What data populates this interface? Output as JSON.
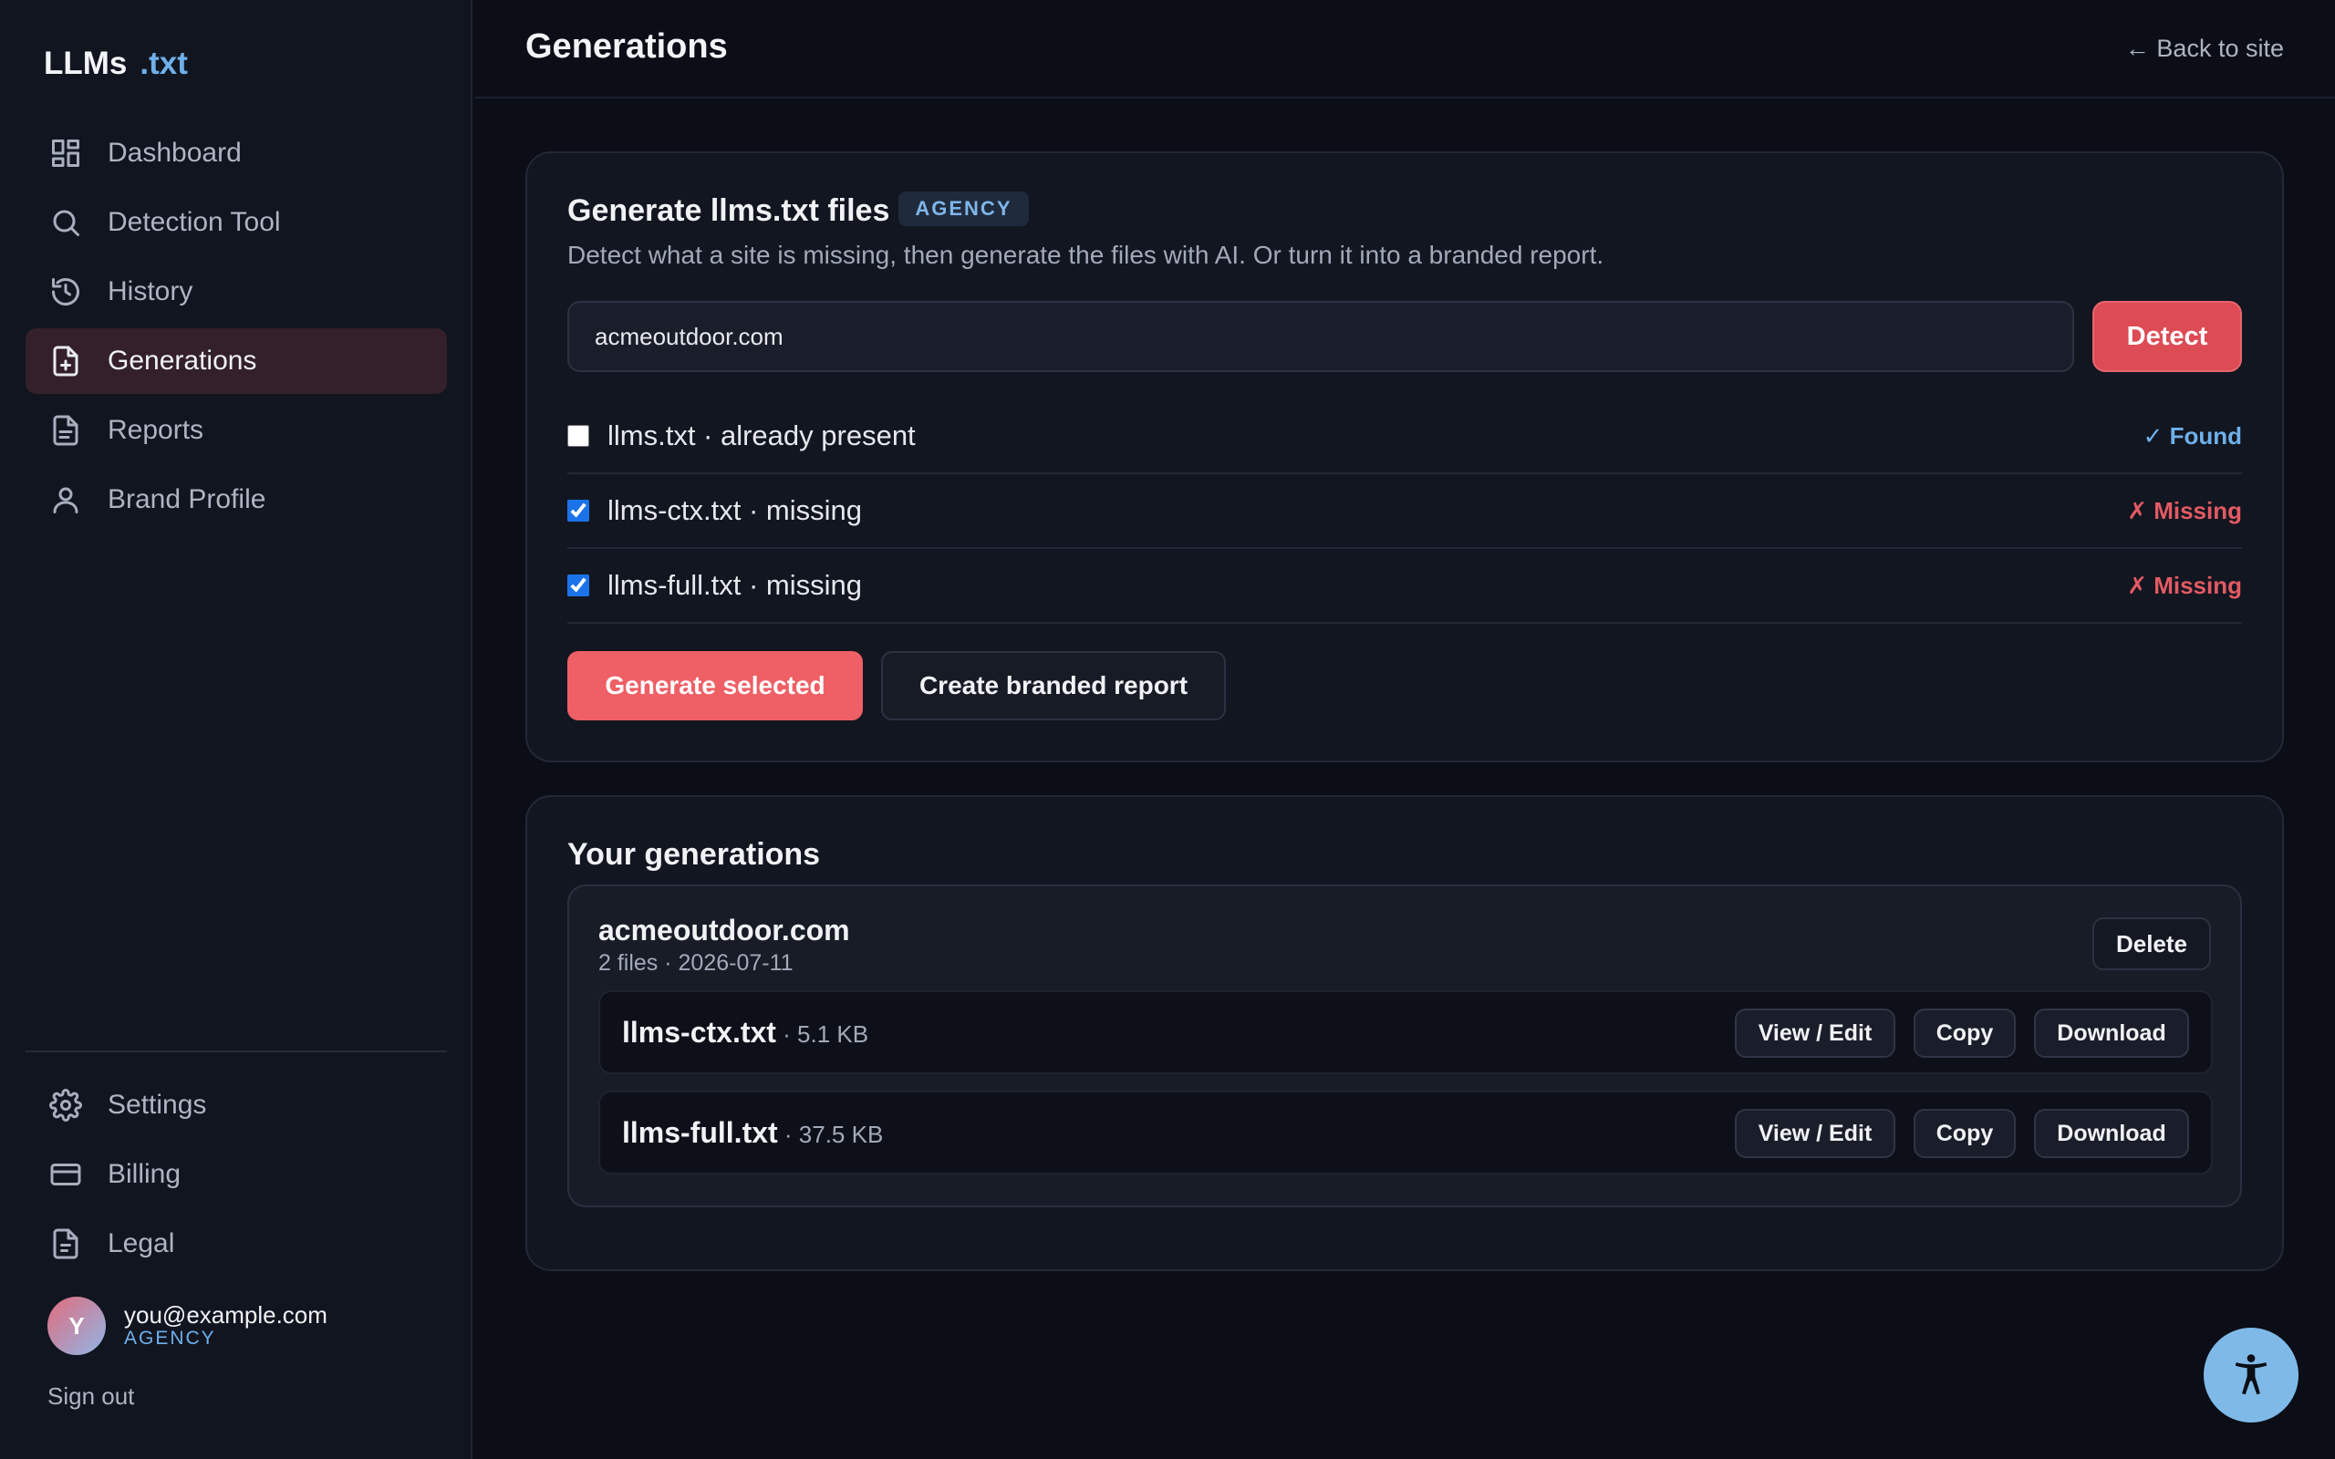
{
  "brand": {
    "name": "LLMs",
    "accent": ".txt"
  },
  "sidebar": {
    "items": [
      {
        "label": "Dashboard",
        "icon": "dashboard-icon"
      },
      {
        "label": "Detection Tool",
        "icon": "search-icon"
      },
      {
        "label": "History",
        "icon": "history-icon"
      },
      {
        "label": "Generations",
        "icon": "file-plus-icon",
        "active": true
      },
      {
        "label": "Reports",
        "icon": "file-text-icon"
      },
      {
        "label": "Brand Profile",
        "icon": "user-icon"
      }
    ],
    "bottom_items": [
      {
        "label": "Settings",
        "icon": "gear-icon"
      },
      {
        "label": "Billing",
        "icon": "credit-card-icon"
      },
      {
        "label": "Legal",
        "icon": "document-icon"
      }
    ],
    "user": {
      "initial": "Y",
      "email": "you@example.com",
      "plan": "AGENCY"
    },
    "signout": "Sign out"
  },
  "header": {
    "title": "Generations",
    "back_link": "← Back to site"
  },
  "generate": {
    "title": "Generate llms.txt files",
    "badge": "AGENCY",
    "subtitle": "Detect what a site is missing, then generate the files with AI. Or turn it into a branded report.",
    "input_value": "acmeoutdoor.com",
    "detect_label": "Detect",
    "files": [
      {
        "label": "llms.txt · already present",
        "checked": false,
        "status": "✓ Found"
      },
      {
        "label": "llms-ctx.txt · missing",
        "checked": true,
        "status": "✗ Missing"
      },
      {
        "label": "llms-full.txt · missing",
        "checked": true,
        "status": "✗ Missing"
      }
    ],
    "generate_label": "Generate selected",
    "report_label": "Create branded report"
  },
  "generations": {
    "title": "Your generations",
    "group": {
      "site": "acmeoutdoor.com",
      "meta": "2 files · 2026-07-11",
      "delete_label": "Delete",
      "files": [
        {
          "name": "llms-ctx.txt",
          "size": " · 5.1 KB"
        },
        {
          "name": "llms-full.txt",
          "size": " · 37.5 KB"
        }
      ],
      "actions": {
        "view": "View / Edit",
        "copy": "Copy",
        "download": "Download"
      }
    }
  },
  "colors": {
    "accent_blue": "#6fb0ea",
    "danger": "#e35a63",
    "primary_button": "#ef5f66",
    "active_nav": "#33202a"
  }
}
